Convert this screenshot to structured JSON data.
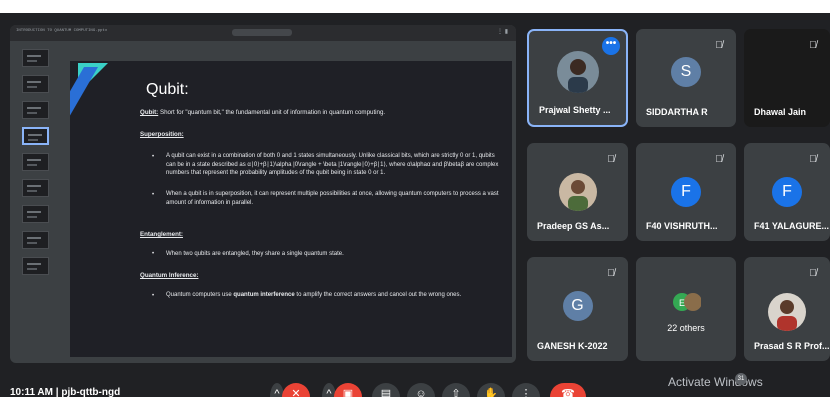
{
  "presentation": {
    "window_title": "INTRODUCTION TO QUANTUM COMPUTING.pptx",
    "slide": {
      "title": "Qubit:",
      "qubit_label": "Qubit:",
      "qubit_text": " Short for \"quantum bit,\" the fundamental unit of information in quantum computing.",
      "superposition_heading": "Superposition:",
      "superposition_bullets": [
        "A qubit can exist in a combination of both 0 and 1 states simultaneously. Unlike classical bits, which are strictly 0 or 1, qubits can be in a state described as α∣0⟩+β∣1⟩\\alpha |0\\rangle + \\beta |1\\rangle∣0⟩+β∣1⟩, where α\\alphaα and β\\betaβ are complex numbers that represent the probability amplitudes of the qubit being in state 0 or 1.",
        "When a qubit is in superposition, it can represent multiple possibilities at once, allowing quantum computers to process a vast amount of information in parallel."
      ],
      "entanglement_heading": "Entanglement:",
      "entanglement_bullets": [
        "When two qubits are entangled, they share a single quantum state."
      ],
      "interference_heading": "Quantum Inference:",
      "interference_pre": "Quantum computers use ",
      "interference_bold": "quantum interference",
      "interference_post": " to amplify the correct answers and cancel out the wrong ones."
    }
  },
  "participants": [
    {
      "name": "Prajwal Shetty ...",
      "type": "photo",
      "active": true
    },
    {
      "name": "SIDDARTHA R",
      "type": "letter",
      "letter": "S",
      "color": "#5f7fa6"
    },
    {
      "name": "Dhawal Jain",
      "type": "dark"
    },
    {
      "name": "Pradeep GS As...",
      "type": "photo"
    },
    {
      "name": "F40 VISHRUTH...",
      "type": "letter",
      "letter": "F",
      "color": "#1a73e8"
    },
    {
      "name": "F41 YALAGURE...",
      "type": "letter",
      "letter": "F",
      "color": "#1a73e8"
    },
    {
      "name": "GANESH K-2022",
      "type": "letter",
      "letter": "G",
      "color": "#5f7fa6"
    },
    {
      "name": "22 others",
      "type": "others"
    },
    {
      "name": "Prasad S R Prof...",
      "type": "photo"
    }
  ],
  "bottom_bar": {
    "clock": "10:11 AM  |  pjb-qttb-ngd",
    "watermark": "Activate Windows",
    "badge": "31"
  },
  "colors": {
    "accent": "#8ab4f8",
    "end_call": "#ea4335",
    "background": "#202124"
  }
}
